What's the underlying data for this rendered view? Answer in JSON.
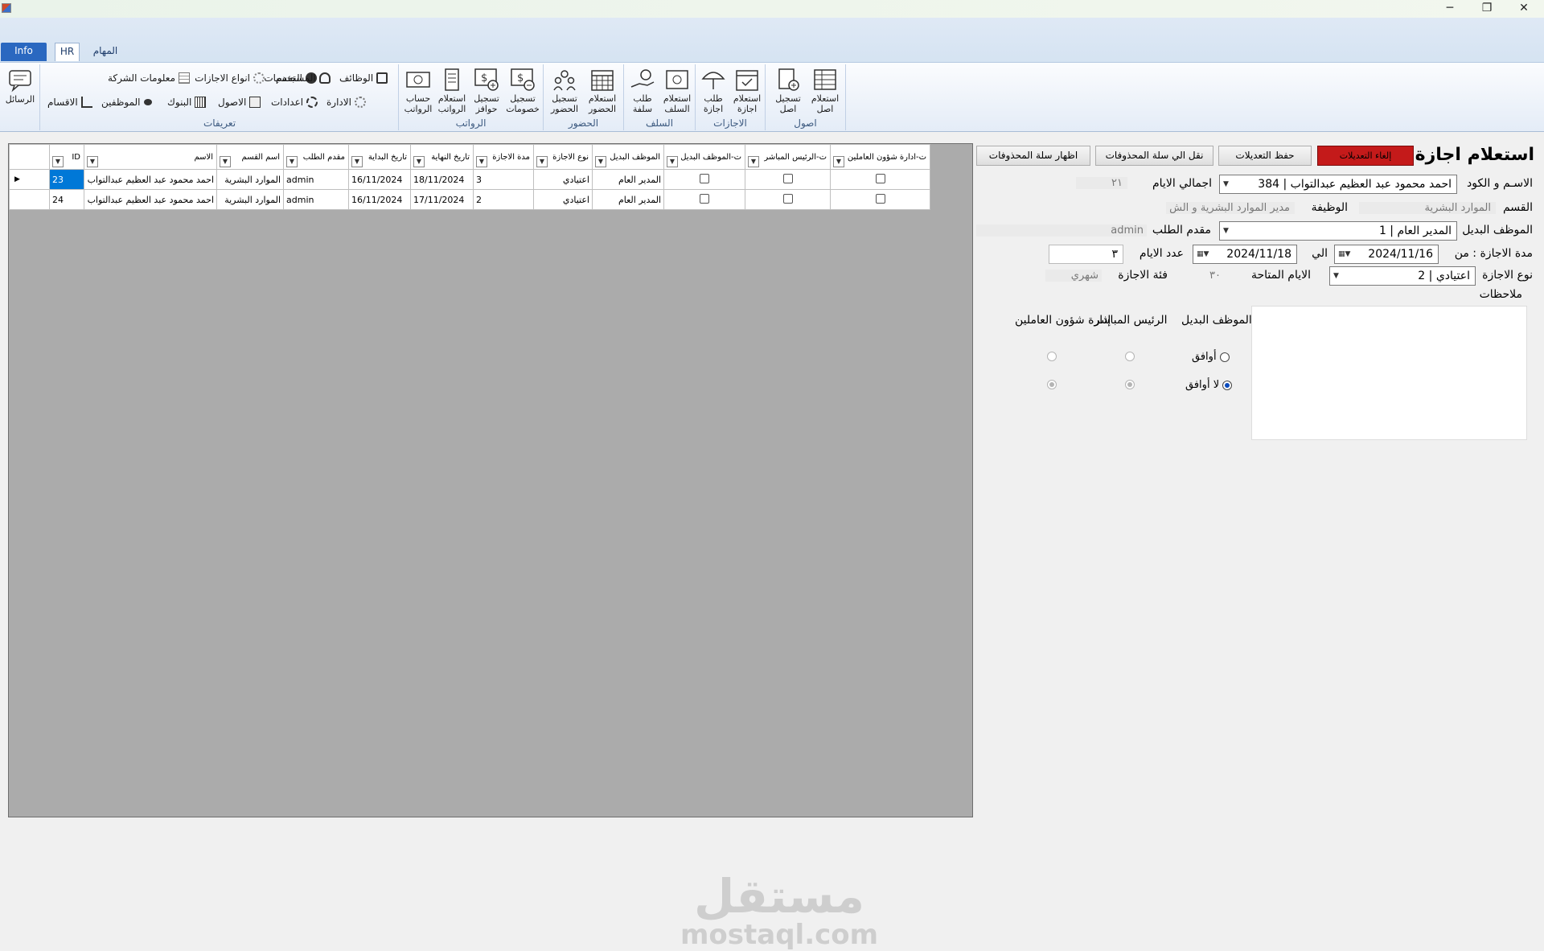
{
  "window": {
    "minimize": "─",
    "restore": "❐",
    "close": "✕"
  },
  "tabs": [
    "Info",
    "HR",
    "المهام"
  ],
  "ribbon": {
    "messages": {
      "label": "الرسائل"
    },
    "definitions": {
      "label": "تعريفات",
      "items": [
        "معلومات الشركة",
        "انواع الاجازات",
        "الجنسيات",
        "المستخدم",
        "الوظائف",
        "الاقسام",
        "الموظفين",
        "البنوك",
        "الاصول",
        "اعدادات",
        "الادارة"
      ]
    },
    "salaries": {
      "label": "الرواتب",
      "items": [
        "حساب الرواتب",
        "استعلام الرواتب",
        "تسجيل حوافز",
        "تسجيل خصومات"
      ]
    },
    "attendance": {
      "label": "الحضور",
      "items": [
        "تسجيل الحضور",
        "استعلام الحضور"
      ]
    },
    "advances": {
      "label": "السلف",
      "items": [
        "طلب سلفة",
        "استعلام السلف"
      ]
    },
    "leaves": {
      "label": "الاجازات",
      "items": [
        "طلب اجازة",
        "استعلام اجازة"
      ]
    },
    "assets": {
      "label": "اصول",
      "items": [
        "تسجيل اصل",
        "استعلام اصل"
      ]
    }
  },
  "grid": {
    "columns": [
      "ID",
      "الاسم",
      "اسم القسم",
      "مقدم الطلب",
      "تاريخ البداية",
      "تاريخ النهاية",
      "مدة الاجازة",
      "نوع الاجازة",
      "الموظف البديل",
      "ت-الموظف البديل",
      "ت-الرئيس المباشر",
      "ت-ادارة شؤون العاملين"
    ],
    "rows": [
      {
        "id": "23",
        "name": "احمد محمود عبد العظيم عبدالتواب",
        "dept": "الموارد البشرية",
        "requester": "admin",
        "start": "16/11/2024",
        "end": "18/11/2024",
        "duration": "3",
        "type": "اعتيادي",
        "substitute": "المدير العام"
      },
      {
        "id": "24",
        "name": "احمد محمود عبد العظيم عبدالتواب",
        "dept": "الموارد البشرية",
        "requester": "admin",
        "start": "16/11/2024",
        "end": "17/11/2024",
        "duration": "2",
        "type": "اعتيادي",
        "substitute": "المدير العام"
      }
    ]
  },
  "form": {
    "title": "استعلام اجازة",
    "buttons": {
      "cancel": "إلغاء التعديلات",
      "save": "حفظ التعديلات",
      "move_to_trash": "نقل الي سلة المحذوفات",
      "show_trash": "اظهار سلة المحذوفات"
    },
    "name_code_label": "الاسـم و الكود",
    "name_code_value": "احمد محمود عبد العظيم عبدالتواب | 384",
    "total_days_label": "اجمالي الايام",
    "total_days_value": "٢١",
    "dept_label": "القسم",
    "dept_value": "الموارد البشرية",
    "job_label": "الوظيفة",
    "job_value": "مدير الموارد البشرية و الش",
    "substitute_label": "الموظف البديل",
    "substitute_value": "المدير العام | 1",
    "requester_label": "مقدم الطلب",
    "requester_value": "admin",
    "period_label": "مدة الاجازة : من",
    "from_date": "2024/11/16",
    "to_label": "الي",
    "to_date": "2024/11/18",
    "days_label": "عدد الايام",
    "days_value": "٣",
    "leave_type_label": "نوع الاجازة",
    "leave_type_value": "اعتيادي | 2",
    "available_days_label": "الايام المتاحة",
    "available_days_value": "٣٠",
    "category_label": "فئة الاجازة",
    "category_value": "شهري",
    "notes_label": "ملاحظات",
    "approval": {
      "col1": "الموظف البديل",
      "col2": "الرئيس المباشر",
      "col3": "إدارة شؤون العاملين",
      "agree": "أوافق",
      "disagree": "لا أوافق"
    }
  },
  "watermark": {
    "ar": "مستقل",
    "en": "mostaql.com"
  }
}
